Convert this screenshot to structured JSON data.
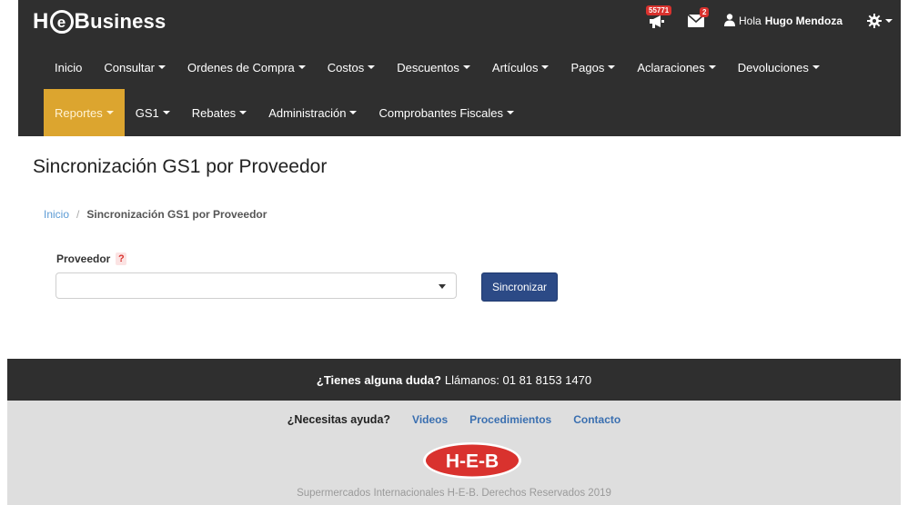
{
  "brand": {
    "h": "H",
    "at": "e",
    "b": "B",
    "rest": "usiness"
  },
  "notifications": {
    "announcements_badge": "55771",
    "messages_badge": "2"
  },
  "user": {
    "greeting": "Hola",
    "name": "Hugo Mendoza"
  },
  "nav": {
    "row1": [
      "Inicio",
      "Consultar",
      "Ordenes de Compra",
      "Costos",
      "Descuentos",
      "Artículos",
      "Pagos",
      "Aclaraciones",
      "Devoluciones"
    ],
    "row2": [
      "Reportes",
      "GS1",
      "Rebates",
      "Administración",
      "Comprobantes Fiscales"
    ],
    "row1_dropdown": [
      false,
      true,
      true,
      true,
      true,
      true,
      true,
      true,
      true
    ],
    "row2_dropdown": [
      true,
      true,
      true,
      true,
      true
    ],
    "active": "Reportes"
  },
  "page": {
    "title": "Sincronización GS1 por Proveedor"
  },
  "breadcrumb": {
    "home": "Inicio",
    "separator": "/",
    "current": "Sincronización GS1 por Proveedor"
  },
  "form": {
    "proveedor_label": "Proveedor",
    "help_mark": "?",
    "selected_value": "",
    "submit_label": "Sincronizar"
  },
  "footer": {
    "question": "¿Tienes alguna duda?",
    "call_text": "Llámanos: 01 81 8153 1470",
    "help_question": "¿Necesitas ayuda?",
    "links": [
      "Videos",
      "Procedimientos",
      "Contacto"
    ],
    "logo_text": "H-E-B",
    "copyright": "Supermercados Internacionales H-E-B. Derechos Reservados 2019"
  },
  "colors": {
    "topbar": "#2f2f2f",
    "active_nav": "#dca52f",
    "button": "#2c4a86",
    "link": "#3a6fb0",
    "heb_red": "#d9322e"
  },
  "icons": [
    "megaphone-icon",
    "envelope-icon",
    "user-icon",
    "gear-icon",
    "caret-down-icon",
    "help-icon"
  ]
}
